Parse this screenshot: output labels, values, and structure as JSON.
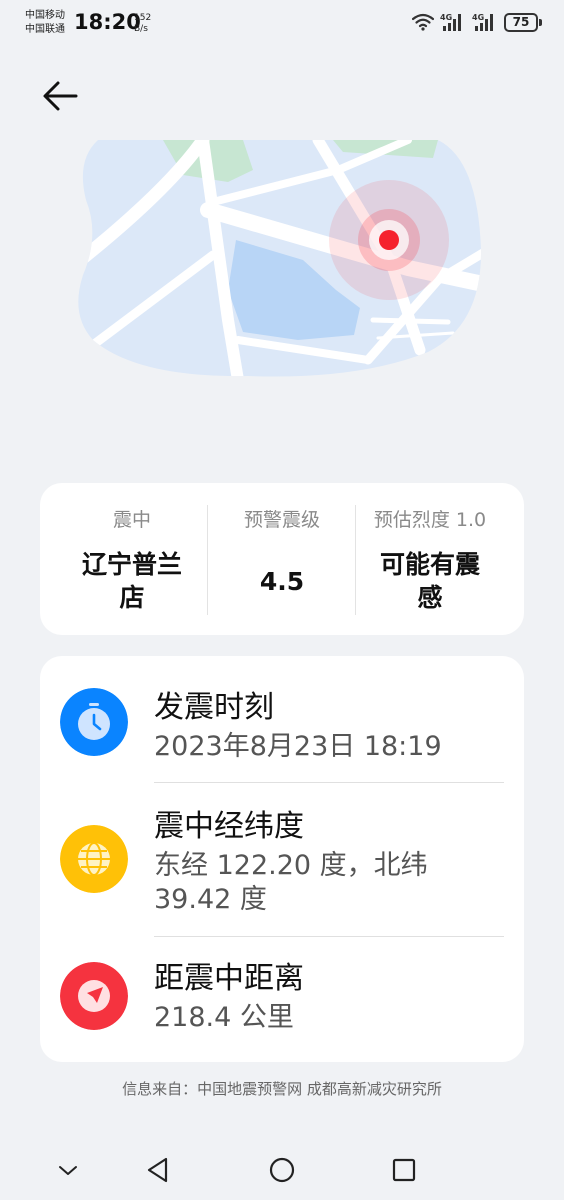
{
  "status_bar": {
    "carrier_1": "中国移动",
    "carrier_2": "中国联通",
    "time": "18:20",
    "net_speed_value": "152",
    "net_speed_unit": "B/s",
    "signal_1_label": "4G",
    "signal_2_label": "4G",
    "battery_level": "75"
  },
  "map": {
    "epicenter_marker": "red-dot-pulse"
  },
  "summary": {
    "epicenter_label": "震中",
    "epicenter_value": "辽宁普兰店",
    "magnitude_label": "预警震级",
    "magnitude_value": "4.5",
    "intensity_label": "预估烈度 1.0",
    "intensity_value": "可能有震感"
  },
  "details": [
    {
      "icon": "stopwatch-icon",
      "color": "#0a84ff",
      "title": "发震时刻",
      "value": "2023年8月23日 18:19"
    },
    {
      "icon": "globe-icon",
      "color": "#ffc107",
      "title": "震中经纬度",
      "value": "东经 122.20 度，北纬 39.42 度"
    },
    {
      "icon": "navigation-arrow-icon",
      "color": "#f5333f",
      "title": "距震中距离",
      "value": "218.4 公里"
    }
  ],
  "source": "信息来自：中国地震预警网 成都高新减灾研究所",
  "colors": {
    "background": "#f0f2f5",
    "card": "#ffffff",
    "accent_red": "#f5333f",
    "accent_blue": "#0a84ff",
    "accent_yellow": "#ffc107"
  }
}
